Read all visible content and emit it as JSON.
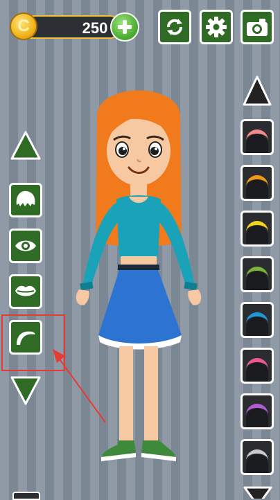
{
  "hud": {
    "coins": "250"
  },
  "colors": {
    "panel_green": "#2f6b24",
    "panel_dark": "#2a2c30",
    "highlight_red": "#e83a32",
    "hair_orange": "#f07a1c",
    "shirt_teal": "#1aa3b8",
    "skirt_blue": "#2c73d2"
  },
  "icons": {
    "coin": "coin-icon",
    "add": "plus-icon",
    "refresh": "refresh-icon",
    "settings": "gear-icon",
    "camera": "camera-icon",
    "categories": [
      "hair-icon",
      "eye-icon",
      "lips-icon",
      "eyebrow-icon"
    ]
  },
  "hair_colors": [
    "#f28a8a",
    "#f19a1a",
    "#f4d21a",
    "#79b33a",
    "#1f9ad6",
    "#e85a8f",
    "#b05ad6",
    "#c9c9c9"
  ],
  "selected_category": "eyebrow"
}
